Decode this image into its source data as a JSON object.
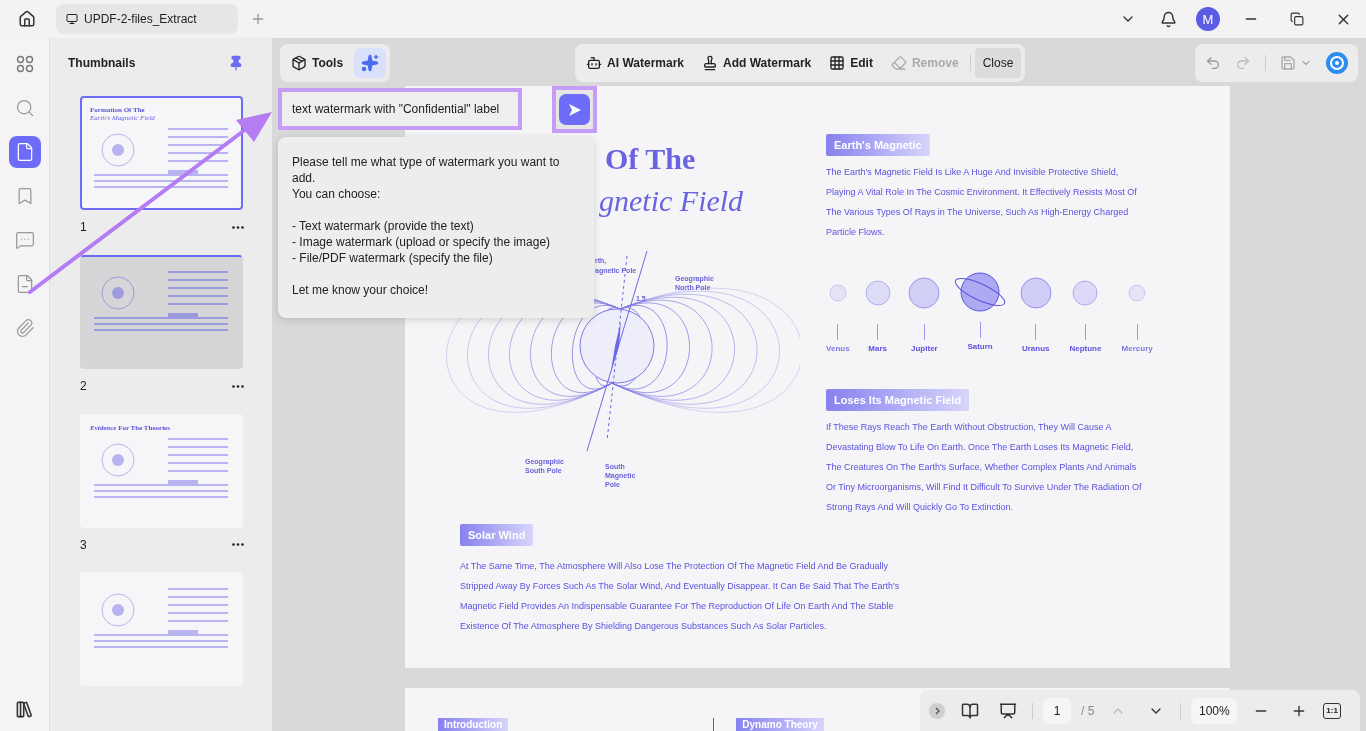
{
  "titlebar": {
    "tab": "UPDF-2-files_Extract",
    "avatar": "M"
  },
  "rail": [
    {
      "kind": "apps",
      "selected": false
    },
    {
      "kind": "search",
      "selected": false
    },
    {
      "kind": "pages",
      "selected": true
    },
    {
      "kind": "bookmarks",
      "selected": false
    },
    {
      "kind": "comments",
      "selected": false
    },
    {
      "kind": "forms",
      "selected": false
    },
    {
      "kind": "attachments",
      "selected": false
    }
  ],
  "thumbnails": {
    "title": "Thumbnails",
    "pages": [
      {
        "number": "1",
        "selected": true,
        "dimmed": false,
        "heading": "Formation Of The",
        "subheading": "Earth's Magnetic Field"
      },
      {
        "number": "2",
        "selected": false,
        "dimmed": true
      },
      {
        "number": "3",
        "selected": false,
        "dimmed": false,
        "heading": "*Evidence* For The Theories"
      },
      {
        "selected": false,
        "dimmed": false
      }
    ]
  },
  "toolbar": {
    "tools": "Tools",
    "ai_assistant_selected": true,
    "actions": [
      {
        "kind": "ai-watermark",
        "label": "AI Watermark",
        "disabled": false
      },
      {
        "kind": "add-watermark",
        "label": "Add Watermark",
        "disabled": false
      },
      {
        "kind": "edit",
        "label": "Edit",
        "disabled": false
      },
      {
        "kind": "remove",
        "label": "Remove",
        "disabled": true
      }
    ],
    "close": "Close"
  },
  "ai_chat": {
    "prompt": "text watermark with \"Confidential\" label",
    "reply": "Please tell me what type of watermark you want to add.\nYou can choose:\n\n- Text watermark (provide the text)\n- Image watermark (upload or specify the image)\n- File/PDF watermark (specify the file)\n\nLet me know your choice!"
  },
  "document": {
    "title_lines": [
      "Of The",
      "gnetic Field"
    ],
    "diagram_labels": [
      "rth,",
      "agnetic Pole",
      "Geographic North Pole",
      "1.5",
      "Geographic South Pole",
      "South Magnetic Pole"
    ],
    "sections": [
      {
        "heading": "Earth's Magnetic",
        "text": "The Earth's Magnetic Field Is Like A Huge And Invisible Protective Shield, Playing A Vital Role In The Cosmic Environment. It Effectively Resists Most Of The Various Types Of Rays in The Universe, Such As High-Energy Charged Particle Flows."
      },
      {
        "heading": "Loses Its Magnetic Field",
        "text": "If These Rays Reach The Earth Without Obstruction, They Will Cause A Devastating Blow To Life On Earth. Once The Earth Loses Its Magnetic Field, The Creatures On The Earth's Surface, Whether Complex Plants And Animals Or Tiny Microorganisms, Will Find It Difficult To Survive Under The Radiation Of Strong Rays And Will Quickly Go To Extinction."
      },
      {
        "heading": "Solar Wind",
        "text": "At The Same Time, The Atmosphere Will Also Lose The Protection Of The Magnetic Field And Be Gradually Stripped Away By Forces Such As The Solar Wind, And Eventually Disappear. It Can Be Said That The Earth's Magnetic Field Provides An Indispensable Guarantee For The Reproduction Of Life On Earth And The Stable Existence Of The Atmosphere By Shielding Dangerous Substances Such As Solar Particles."
      }
    ],
    "planets": [
      "Venus",
      "Mars",
      "Jupiter",
      "Saturn",
      "Uranus",
      "Neptune",
      "Mercury"
    ],
    "next_page_labels": [
      "Introduction",
      "Dynamo Theory"
    ]
  },
  "page_nav": {
    "page": "1",
    "total": "/ 5",
    "zoom": "100%",
    "actual_size": "1:1",
    "prev_disabled": true
  }
}
